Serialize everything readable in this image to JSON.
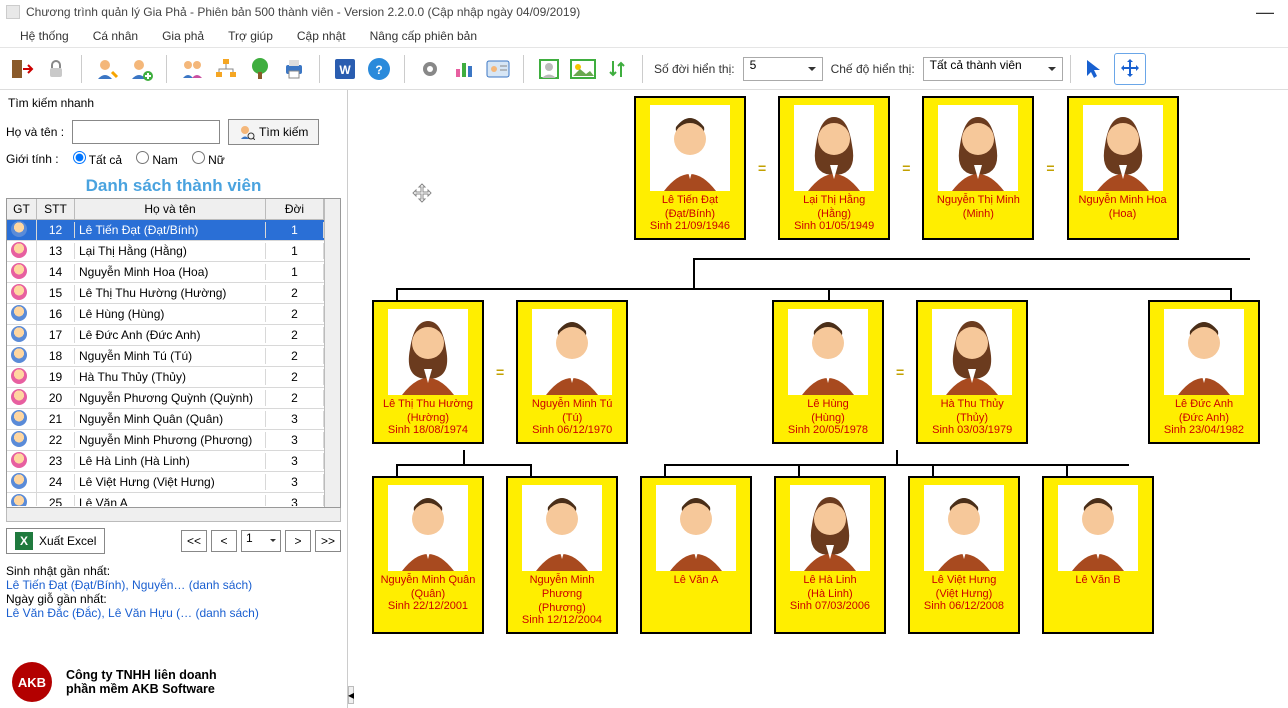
{
  "window": {
    "title": "Chương trình quản lý Gia Phả - Phiên bản 500 thành viên - Version 2.2.0.0 (Cập nhập ngày 04/09/2019)"
  },
  "menu": [
    "Hệ thống",
    "Cá nhân",
    "Gia phả",
    "Trợ giúp",
    "Cập nhật",
    "Nâng cấp phiên bản"
  ],
  "toolbar": {
    "generation_label": "Số đời hiển thị:",
    "generation_value": "5",
    "mode_label": "Chế độ hiển thị:",
    "mode_value": "Tất cả thành viên"
  },
  "sidebar": {
    "quick_search_title": "Tìm kiếm nhanh",
    "name_label": "Họ và tên :",
    "search_btn": "Tìm kiếm",
    "gender_label": "Giới tính :",
    "gender_opts": [
      "Tất cả",
      "Nam",
      "Nữ"
    ],
    "list_title": "Danh sách thành viên",
    "columns": {
      "gt": "GT",
      "stt": "STT",
      "name": "Họ và tên",
      "gen": "Đời"
    },
    "rows": [
      {
        "g": "m",
        "stt": "12",
        "name": "Lê Tiến Đạt (Đạt/Bính)",
        "gen": "1",
        "sel": true
      },
      {
        "g": "f",
        "stt": "13",
        "name": "Lại Thị Hằng (Hằng)",
        "gen": "1"
      },
      {
        "g": "f",
        "stt": "14",
        "name": "Nguyễn Minh Hoa (Hoa)",
        "gen": "1"
      },
      {
        "g": "f",
        "stt": "15",
        "name": "Lê Thị Thu Hường (Hường)",
        "gen": "2"
      },
      {
        "g": "m",
        "stt": "16",
        "name": "Lê Hùng (Hùng)",
        "gen": "2"
      },
      {
        "g": "m",
        "stt": "17",
        "name": "Lê Đức Anh (Đức Anh)",
        "gen": "2"
      },
      {
        "g": "m",
        "stt": "18",
        "name": "Nguyễn Minh Tú (Tú)",
        "gen": "2"
      },
      {
        "g": "f",
        "stt": "19",
        "name": "Hà Thu Thủy (Thủy)",
        "gen": "2"
      },
      {
        "g": "f",
        "stt": "20",
        "name": "Nguyễn Phương Quỳnh (Quỳnh)",
        "gen": "2"
      },
      {
        "g": "m",
        "stt": "21",
        "name": "Nguyễn Minh Quân (Quân)",
        "gen": "3"
      },
      {
        "g": "m",
        "stt": "22",
        "name": "Nguyễn Minh Phương (Phương)",
        "gen": "3"
      },
      {
        "g": "f",
        "stt": "23",
        "name": "Lê Hà Linh (Hà Linh)",
        "gen": "3"
      },
      {
        "g": "m",
        "stt": "24",
        "name": "Lê Việt Hưng (Việt Hưng)",
        "gen": "3"
      },
      {
        "g": "m",
        "stt": "25",
        "name": "Lê Văn A",
        "gen": "3"
      }
    ],
    "excel_btn": "Xuất Excel",
    "pager": {
      "first": "<<",
      "prev": "<",
      "page": "1",
      "next": ">",
      "last": ">>"
    },
    "birthday_label": "Sinh nhật gần nhất:",
    "birthday_link": "Lê Tiến Đạt (Đạt/Bính), Nguyễn… (danh sách)",
    "death_label": "Ngày giỗ gần nhất:",
    "death_link": "Lê Văn Đắc (Đắc), Lê Văn Hựu (… (danh sách)",
    "company_line1": "Công ty TNHH liên doanh",
    "company_line2": "phần mềm AKB Software",
    "logo": "AKB"
  },
  "tree": {
    "r1": [
      {
        "g": "m",
        "name": "Lê Tiến Đạt",
        "nick": "(Đạt/Bính)",
        "birth": "Sinh 21/09/1946"
      },
      {
        "g": "f",
        "name": "Lại Thị Hằng",
        "nick": "(Hằng)",
        "birth": "Sinh 01/05/1949"
      },
      {
        "g": "f",
        "name": "Nguyễn Thị Minh",
        "nick": "(Minh)",
        "birth": ""
      },
      {
        "g": "f",
        "name": "Nguyễn Minh Hoa",
        "nick": "(Hoa)",
        "birth": ""
      }
    ],
    "r2": [
      {
        "g": "f",
        "name": "Lê Thị Thu Hường",
        "nick": "(Hường)",
        "birth": "Sinh 18/08/1974"
      },
      {
        "g": "m",
        "name": "Nguyễn Minh Tú",
        "nick": "(Tú)",
        "birth": "Sinh 06/12/1970"
      },
      {
        "g": "m",
        "name": "Lê Hùng",
        "nick": "(Hùng)",
        "birth": "Sinh 20/05/1978"
      },
      {
        "g": "f",
        "name": "Hà Thu Thủy",
        "nick": "(Thủy)",
        "birth": "Sinh 03/03/1979"
      },
      {
        "g": "m",
        "name": "Lê Đức Anh",
        "nick": "(Đức Anh)",
        "birth": "Sinh 23/04/1982"
      }
    ],
    "r3": [
      {
        "g": "m",
        "name": "Nguyễn Minh Quân",
        "nick": "(Quân)",
        "birth": "Sinh 22/12/2001"
      },
      {
        "g": "m",
        "name": "Nguyễn Minh Phương",
        "nick": "(Phương)",
        "birth": "Sinh 12/12/2004"
      },
      {
        "g": "m",
        "name": "Lê Văn A",
        "nick": "",
        "birth": ""
      },
      {
        "g": "f",
        "name": "Lê Hà Linh",
        "nick": "(Hà Linh)",
        "birth": "Sinh 07/03/2006"
      },
      {
        "g": "m",
        "name": "Lê Việt Hưng",
        "nick": "(Việt Hưng)",
        "birth": "Sinh 06/12/2008"
      },
      {
        "g": "m",
        "name": "Lê Văn B",
        "nick": "",
        "birth": ""
      }
    ]
  }
}
